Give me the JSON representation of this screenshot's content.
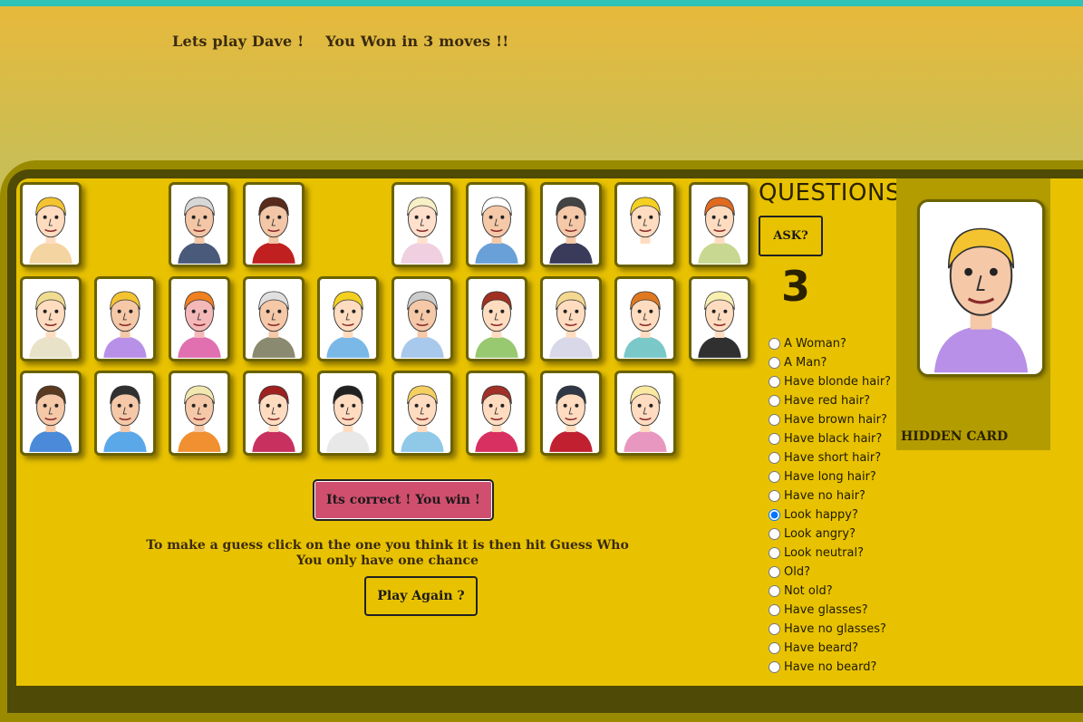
{
  "header": {
    "greeting": "Lets play Dave !",
    "result": "You Won in 3 moves !!"
  },
  "board": {
    "cards": [
      {
        "name": "card-1",
        "row": 0,
        "col": 0,
        "hair": "#f4c430",
        "skin": "#ffdcc0",
        "shirt": "#f4d4a0"
      },
      {
        "name": "card-2",
        "row": 0,
        "col": 2,
        "hair": "#d7d7d7",
        "skin": "#f2c6a6",
        "shirt": "#4a5a7a"
      },
      {
        "name": "card-3",
        "row": 0,
        "col": 3,
        "hair": "#5a2a1a",
        "skin": "#f2c6a6",
        "shirt": "#c02020"
      },
      {
        "name": "card-4",
        "row": 0,
        "col": 5,
        "hair": "#f7f0c6",
        "skin": "#ffe0cc",
        "shirt": "#f0d0e0"
      },
      {
        "name": "card-5",
        "row": 0,
        "col": 6,
        "hair": "#ffffff",
        "skin": "#f5c8a8",
        "shirt": "#6aa0d8"
      },
      {
        "name": "card-6",
        "row": 0,
        "col": 7,
        "hair": "#444444",
        "skin": "#f5c8a8",
        "shirt": "#3a3a5a"
      },
      {
        "name": "card-7",
        "row": 0,
        "col": 8,
        "hair": "#f4d020",
        "skin": "#ffdcc0",
        "shirt": "#ffffff"
      },
      {
        "name": "card-8",
        "row": 0,
        "col": 9,
        "hair": "#e06a20",
        "skin": "#ffdcc0",
        "shirt": "#c8d890"
      },
      {
        "name": "card-9",
        "row": 1,
        "col": 0,
        "hair": "#f0dc90",
        "skin": "#ffdcc0",
        "shirt": "#e8e2c8"
      },
      {
        "name": "card-10",
        "row": 1,
        "col": 1,
        "hair": "#f4c430",
        "skin": "#f5c8a8",
        "shirt": "#b890e8"
      },
      {
        "name": "card-11",
        "row": 1,
        "col": 2,
        "hair": "#f08020",
        "skin": "#f5b8b8",
        "shirt": "#e070b0"
      },
      {
        "name": "card-12",
        "row": 1,
        "col": 3,
        "hair": "#e0e0e0",
        "skin": "#f5c8a8",
        "shirt": "#8a8a70"
      },
      {
        "name": "card-13",
        "row": 1,
        "col": 4,
        "hair": "#f4d020",
        "skin": "#ffdcc0",
        "shirt": "#7ab8e8"
      },
      {
        "name": "card-14",
        "row": 1,
        "col": 5,
        "hair": "#cccccc",
        "skin": "#f5c8a8",
        "shirt": "#a8c8ec"
      },
      {
        "name": "card-15",
        "row": 1,
        "col": 6,
        "hair": "#a03020",
        "skin": "#ffdcc0",
        "shirt": "#98c870"
      },
      {
        "name": "card-16",
        "row": 1,
        "col": 7,
        "hair": "#f4d890",
        "skin": "#ffdcc0",
        "shirt": "#d8d8e8"
      },
      {
        "name": "card-17",
        "row": 1,
        "col": 8,
        "hair": "#e07820",
        "skin": "#ffdcc0",
        "shirt": "#7ac8c8"
      },
      {
        "name": "card-18",
        "row": 1,
        "col": 9,
        "hair": "#f8f0b0",
        "skin": "#ffdcc0",
        "shirt": "#303030"
      },
      {
        "name": "card-19",
        "row": 2,
        "col": 0,
        "hair": "#5a3a20",
        "skin": "#f5c8a8",
        "shirt": "#4a8ad8"
      },
      {
        "name": "card-20",
        "row": 2,
        "col": 1,
        "hair": "#303030",
        "skin": "#f5c8a8",
        "shirt": "#5aa8e8"
      },
      {
        "name": "card-21",
        "row": 2,
        "col": 2,
        "hair": "#f0e8b0",
        "skin": "#f5c8a8",
        "shirt": "#f09030"
      },
      {
        "name": "card-22",
        "row": 2,
        "col": 3,
        "hair": "#a02020",
        "skin": "#ffdcc0",
        "shirt": "#c83060"
      },
      {
        "name": "card-23",
        "row": 2,
        "col": 4,
        "hair": "#202020",
        "skin": "#ffdcc0",
        "shirt": "#e8e8e8"
      },
      {
        "name": "card-24",
        "row": 2,
        "col": 5,
        "hair": "#f4d060",
        "skin": "#ffdcc0",
        "shirt": "#90c8e8"
      },
      {
        "name": "card-25",
        "row": 2,
        "col": 6,
        "hair": "#a03028",
        "skin": "#ffdcc0",
        "shirt": "#d83060"
      },
      {
        "name": "card-26",
        "row": 2,
        "col": 7,
        "hair": "#303848",
        "skin": "#ffdcc0",
        "shirt": "#c02030"
      },
      {
        "name": "card-27",
        "row": 2,
        "col": 8,
        "hair": "#f8e8a0",
        "skin": "#ffdcc0",
        "shirt": "#e898c0"
      }
    ],
    "guess_button": "Its correct ! You win !",
    "instruction_line1": "To make a guess click on the one you think it is then hit Guess Who",
    "instruction_line2": "You only have one chance",
    "play_again": "Play Again ?"
  },
  "sidebar": {
    "title": "QUESTIONS",
    "ask_button": "ASK?",
    "moves": "3",
    "selected_question": "Look happy?",
    "questions": [
      "A Woman?",
      "A Man?",
      "Have blonde hair?",
      "Have red hair?",
      "Have brown hair?",
      "Have black hair?",
      "Have short hair?",
      "Have long hair?",
      "Have no hair?",
      "Look happy?",
      "Look angry?",
      "Look neutral?",
      "Old?",
      "Not old?",
      "Have glasses?",
      "Have no glasses?",
      "Have beard?",
      "Have no beard?"
    ]
  },
  "hidden": {
    "label": "HIDDEN CARD",
    "hair": "#f4c430",
    "skin": "#f5c8a8",
    "shirt": "#b890e8"
  },
  "colors": {
    "topbar": "#2fc2b5",
    "board": "#e8c200",
    "guess_button": "#d14f6e"
  }
}
